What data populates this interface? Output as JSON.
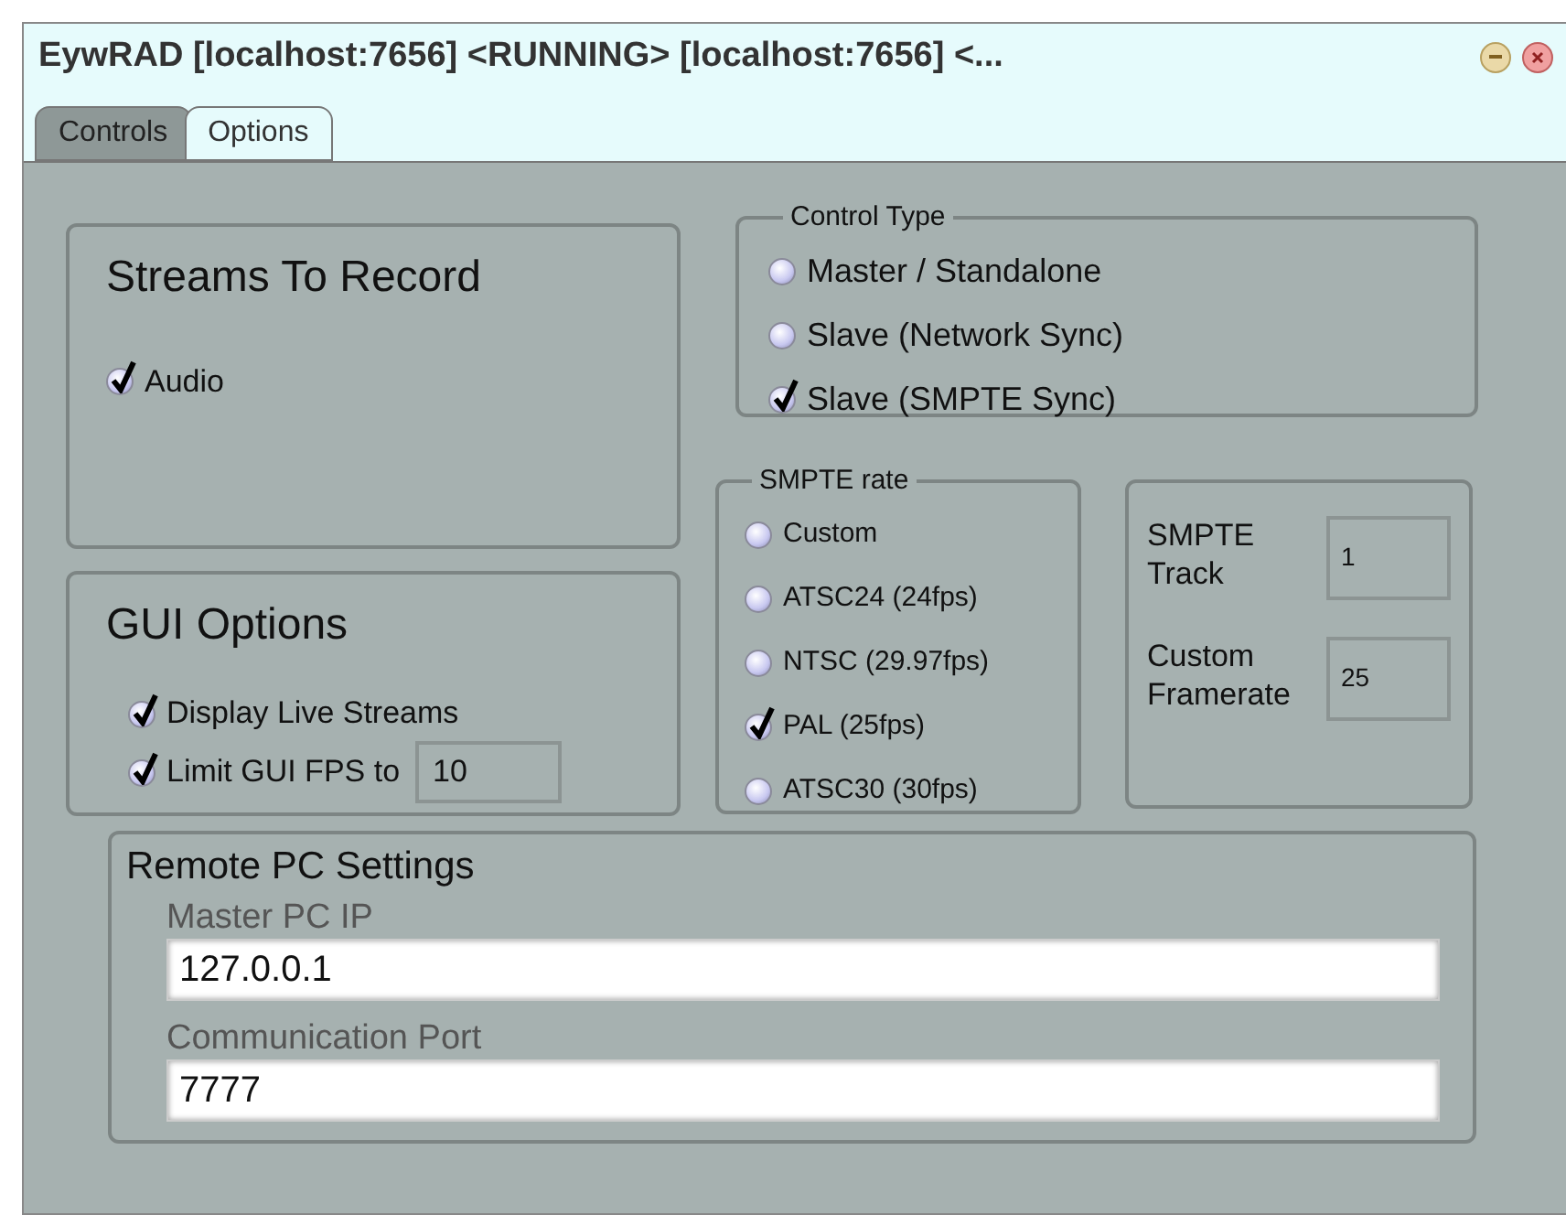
{
  "window": {
    "title": "EywRAD [localhost:7656] <RUNNING> [localhost:7656] <..."
  },
  "tabs": [
    {
      "label": "Controls",
      "selected": false
    },
    {
      "label": "Options",
      "selected": true
    }
  ],
  "streams_to_record": {
    "title": "Streams To Record",
    "options": [
      {
        "label": "Audio",
        "checked": true
      }
    ]
  },
  "gui_options": {
    "title": "GUI Options",
    "options": [
      {
        "label": "Display Live Streams",
        "checked": true
      },
      {
        "label": "Limit GUI FPS to",
        "checked": true,
        "value": "10"
      }
    ]
  },
  "control_type": {
    "title": "Control Type",
    "options": [
      {
        "label": "Master / Standalone",
        "selected": false
      },
      {
        "label": "Slave (Network Sync)",
        "selected": false
      },
      {
        "label": "Slave (SMPTE Sync)",
        "selected": true
      }
    ]
  },
  "smpte_rate": {
    "title": "SMPTE rate",
    "options": [
      {
        "label": "Custom",
        "selected": false
      },
      {
        "label": "ATSC24 (24fps)",
        "selected": false
      },
      {
        "label": "NTSC (29.97fps)",
        "selected": false
      },
      {
        "label": "PAL (25fps)",
        "selected": true
      },
      {
        "label": "ATSC30 (30fps)",
        "selected": false
      }
    ]
  },
  "smpte_fields": [
    {
      "label": "SMPTE Track",
      "value": "1"
    },
    {
      "label": "Custom Framerate",
      "value": "25"
    }
  ],
  "remote_pc_settings": {
    "title": "Remote PC Settings",
    "fields": [
      {
        "label": "Master PC IP",
        "value": "127.0.0.1"
      },
      {
        "label": "Communication Port",
        "value": "7777"
      }
    ]
  }
}
